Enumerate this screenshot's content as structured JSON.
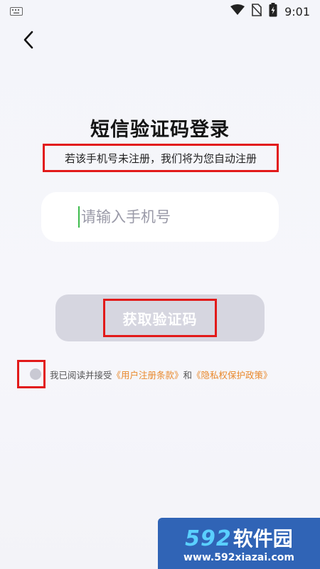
{
  "status_bar": {
    "time": "9:01",
    "icons": [
      "keyboard-icon",
      "wifi-icon",
      "no-sim-icon",
      "battery-charging-icon"
    ]
  },
  "header": {
    "back_icon": "chevron-left-icon"
  },
  "title": "短信验证码登录",
  "hint": "若该手机号未注册，我们将为您自动注册",
  "phone_input": {
    "placeholder": "请输入手机号",
    "value": ""
  },
  "get_code_button": {
    "label": "获取验证码"
  },
  "agreement": {
    "prefix": "我已阅读并接受",
    "terms_link": "《用户注册条款》",
    "connector": "和",
    "privacy_link": "《隐私权保护政策》",
    "checked": false
  },
  "watermark": {
    "number": "592",
    "text": "软件园",
    "url": "www.592xiazai.com"
  },
  "colors": {
    "highlight_border": "#e21a1a",
    "link": "#e9892b",
    "button_disabled": "#d6d6e0",
    "caret": "#3dbb4c",
    "watermark_bg": "#3064b6"
  }
}
